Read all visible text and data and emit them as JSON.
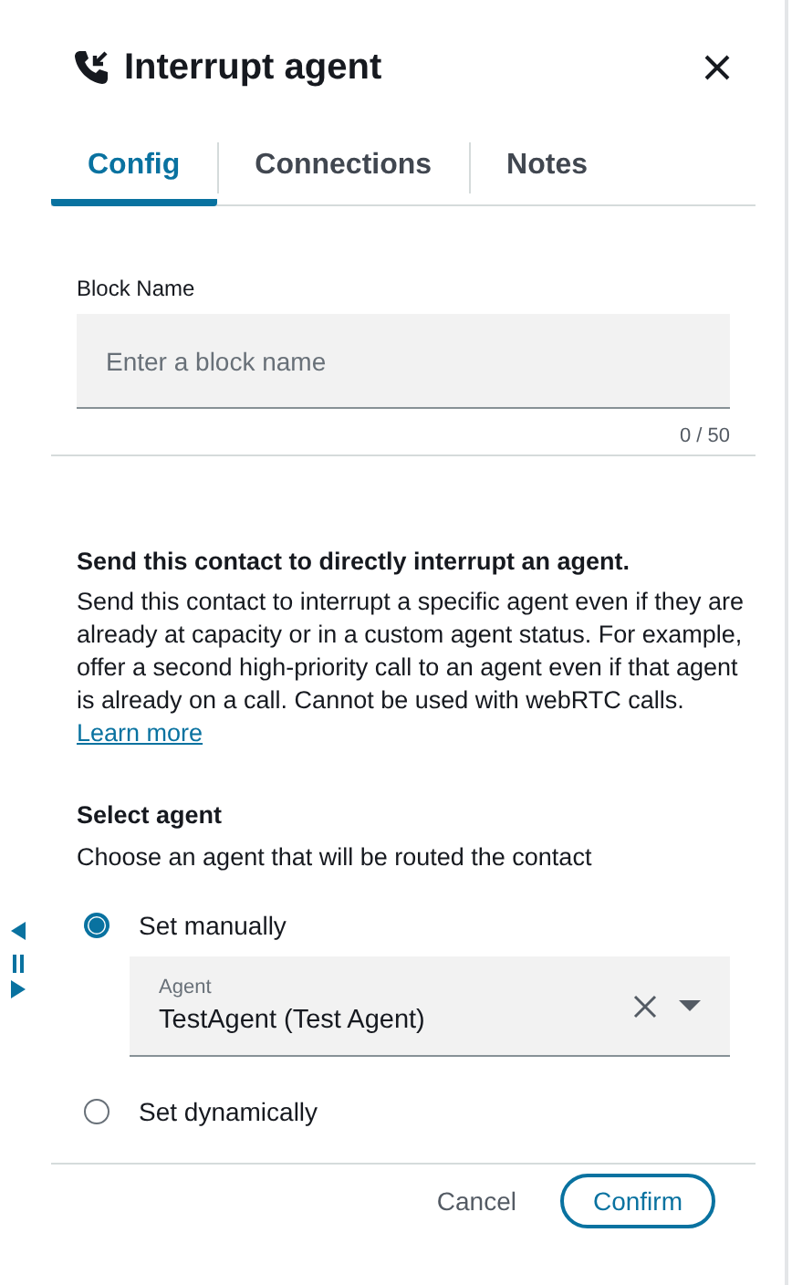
{
  "header": {
    "title": "Interrupt agent"
  },
  "tabs": [
    {
      "label": "Config",
      "selected": true
    },
    {
      "label": "Connections",
      "selected": false
    },
    {
      "label": "Notes",
      "selected": false
    }
  ],
  "block_name": {
    "label": "Block Name",
    "placeholder": "Enter a block name",
    "counter": "0 / 50"
  },
  "description": {
    "heading": "Send this contact to directly interrupt an agent.",
    "text": "Send this contact to interrupt a specific agent even if they are already at capacity or in a custom agent status. For example, offer a second high-priority call to an agent even if that agent is already on a call. Cannot be used with webRTC calls.",
    "link": "Learn more"
  },
  "select_agent": {
    "heading": "Select agent",
    "hint": "Choose an agent that will be routed the contact",
    "options": [
      {
        "label": "Set manually",
        "selected": true,
        "agent_field": {
          "label": "Agent",
          "value": "TestAgent (Test Agent)"
        }
      },
      {
        "label": "Set dynamically",
        "selected": false
      }
    ]
  },
  "footer": {
    "buttons": [
      {
        "label": "Cancel",
        "kind": "link"
      },
      {
        "label": "Confirm",
        "kind": "outline"
      }
    ]
  }
}
